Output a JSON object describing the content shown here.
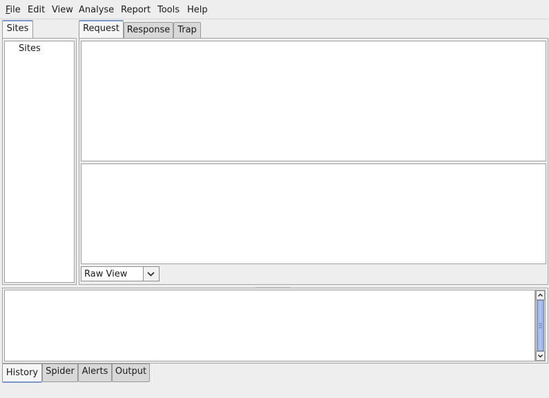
{
  "menubar": {
    "items": [
      {
        "label_first": "F",
        "label_rest": "ile"
      },
      {
        "label": "Edit"
      },
      {
        "label": "View"
      },
      {
        "label": "Analyse"
      },
      {
        "label": "Report"
      },
      {
        "label": "Tools"
      },
      {
        "label": "Help"
      }
    ]
  },
  "sites_panel": {
    "tab_label": "Sites",
    "tree_root": "Sites"
  },
  "main_tabs": [
    "Request",
    "Response",
    "Trap"
  ],
  "request": {
    "view_select": {
      "value": "Raw View"
    }
  },
  "bottom_tabs": [
    "History",
    "Spider",
    "Alerts",
    "Output"
  ],
  "colors": {
    "selected_tab_accent": "#7b96c8",
    "scroll_thumb": "#9fb5e6"
  }
}
